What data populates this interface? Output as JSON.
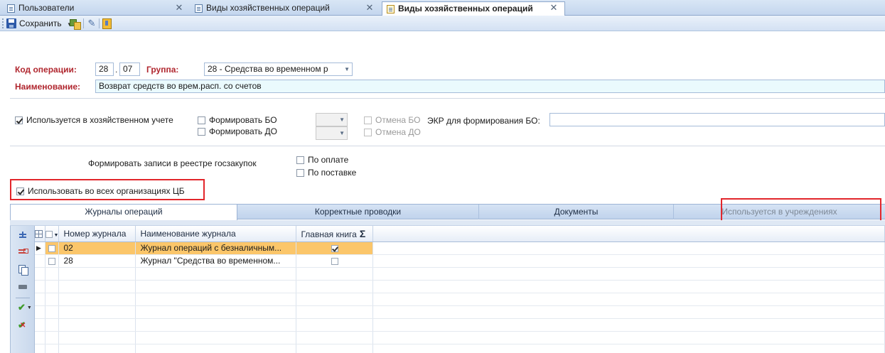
{
  "tabs": [
    {
      "label": "Пользователи",
      "active": false
    },
    {
      "label": "Виды хозяйственных операций",
      "active": false
    },
    {
      "label": "Виды хозяйственных операций",
      "active": true
    }
  ],
  "tab_close_glyph": "✕",
  "toolbar": {
    "save_label": "Сохранить",
    "dropdown_glyph": "▼",
    "icons": [
      "save-icon",
      "organization-icon",
      "pencil-icon",
      "exit-icon"
    ]
  },
  "form": {
    "code_label": "Код операции:",
    "code_part1": "28",
    "code_part2": "07",
    "group_label": "Группа:",
    "group_value": "28 - Средства во временном р",
    "name_label": "Наименование:",
    "name_value": "Возврат средств во врем.расп. со счетов",
    "used_in_accounting": {
      "label": "Используется в хозяйственном учете",
      "checked": true
    },
    "form_bo": {
      "label": "Формировать БО",
      "checked": false
    },
    "form_do": {
      "label": "Формировать ДО",
      "checked": false
    },
    "cancel_bo": {
      "label": "Отмена БО",
      "checked": false
    },
    "cancel_do": {
      "label": "Отмена ДО",
      "checked": false
    },
    "ekr_label": "ЭКР для формирования БО:",
    "ekr_value": "",
    "procurement_label": "Формировать записи в реестре госзакупок",
    "by_payment": {
      "label": "По оплате",
      "checked": false
    },
    "by_delivery": {
      "label": "По поставке",
      "checked": false
    },
    "use_all_orgs": {
      "label": "Использовать во всех организациях ЦБ",
      "checked": true
    }
  },
  "subtabs": [
    {
      "label": "Журналы операций",
      "active": true
    },
    {
      "label": "Корректные проводки",
      "active": false
    },
    {
      "label": "Документы",
      "active": false
    },
    {
      "label": "Используется в учреждениях",
      "active": false
    }
  ],
  "grid": {
    "columns": [
      "Номер журнала",
      "Наименование журнала",
      "Главная книга"
    ],
    "sigma": "Σ",
    "rows": [
      {
        "selected": true,
        "number": "02",
        "name": "Журнал операций с безналичным...",
        "main_book": true
      },
      {
        "selected": false,
        "number": "28",
        "name": "Журнал \"Средства во временном...",
        "main_book": false
      }
    ]
  },
  "colors": {
    "label_red": "#b0262e",
    "highlight_frame": "#e2262b",
    "selected_row": "#fbc66a",
    "name_field_bg": "#eafafd"
  }
}
